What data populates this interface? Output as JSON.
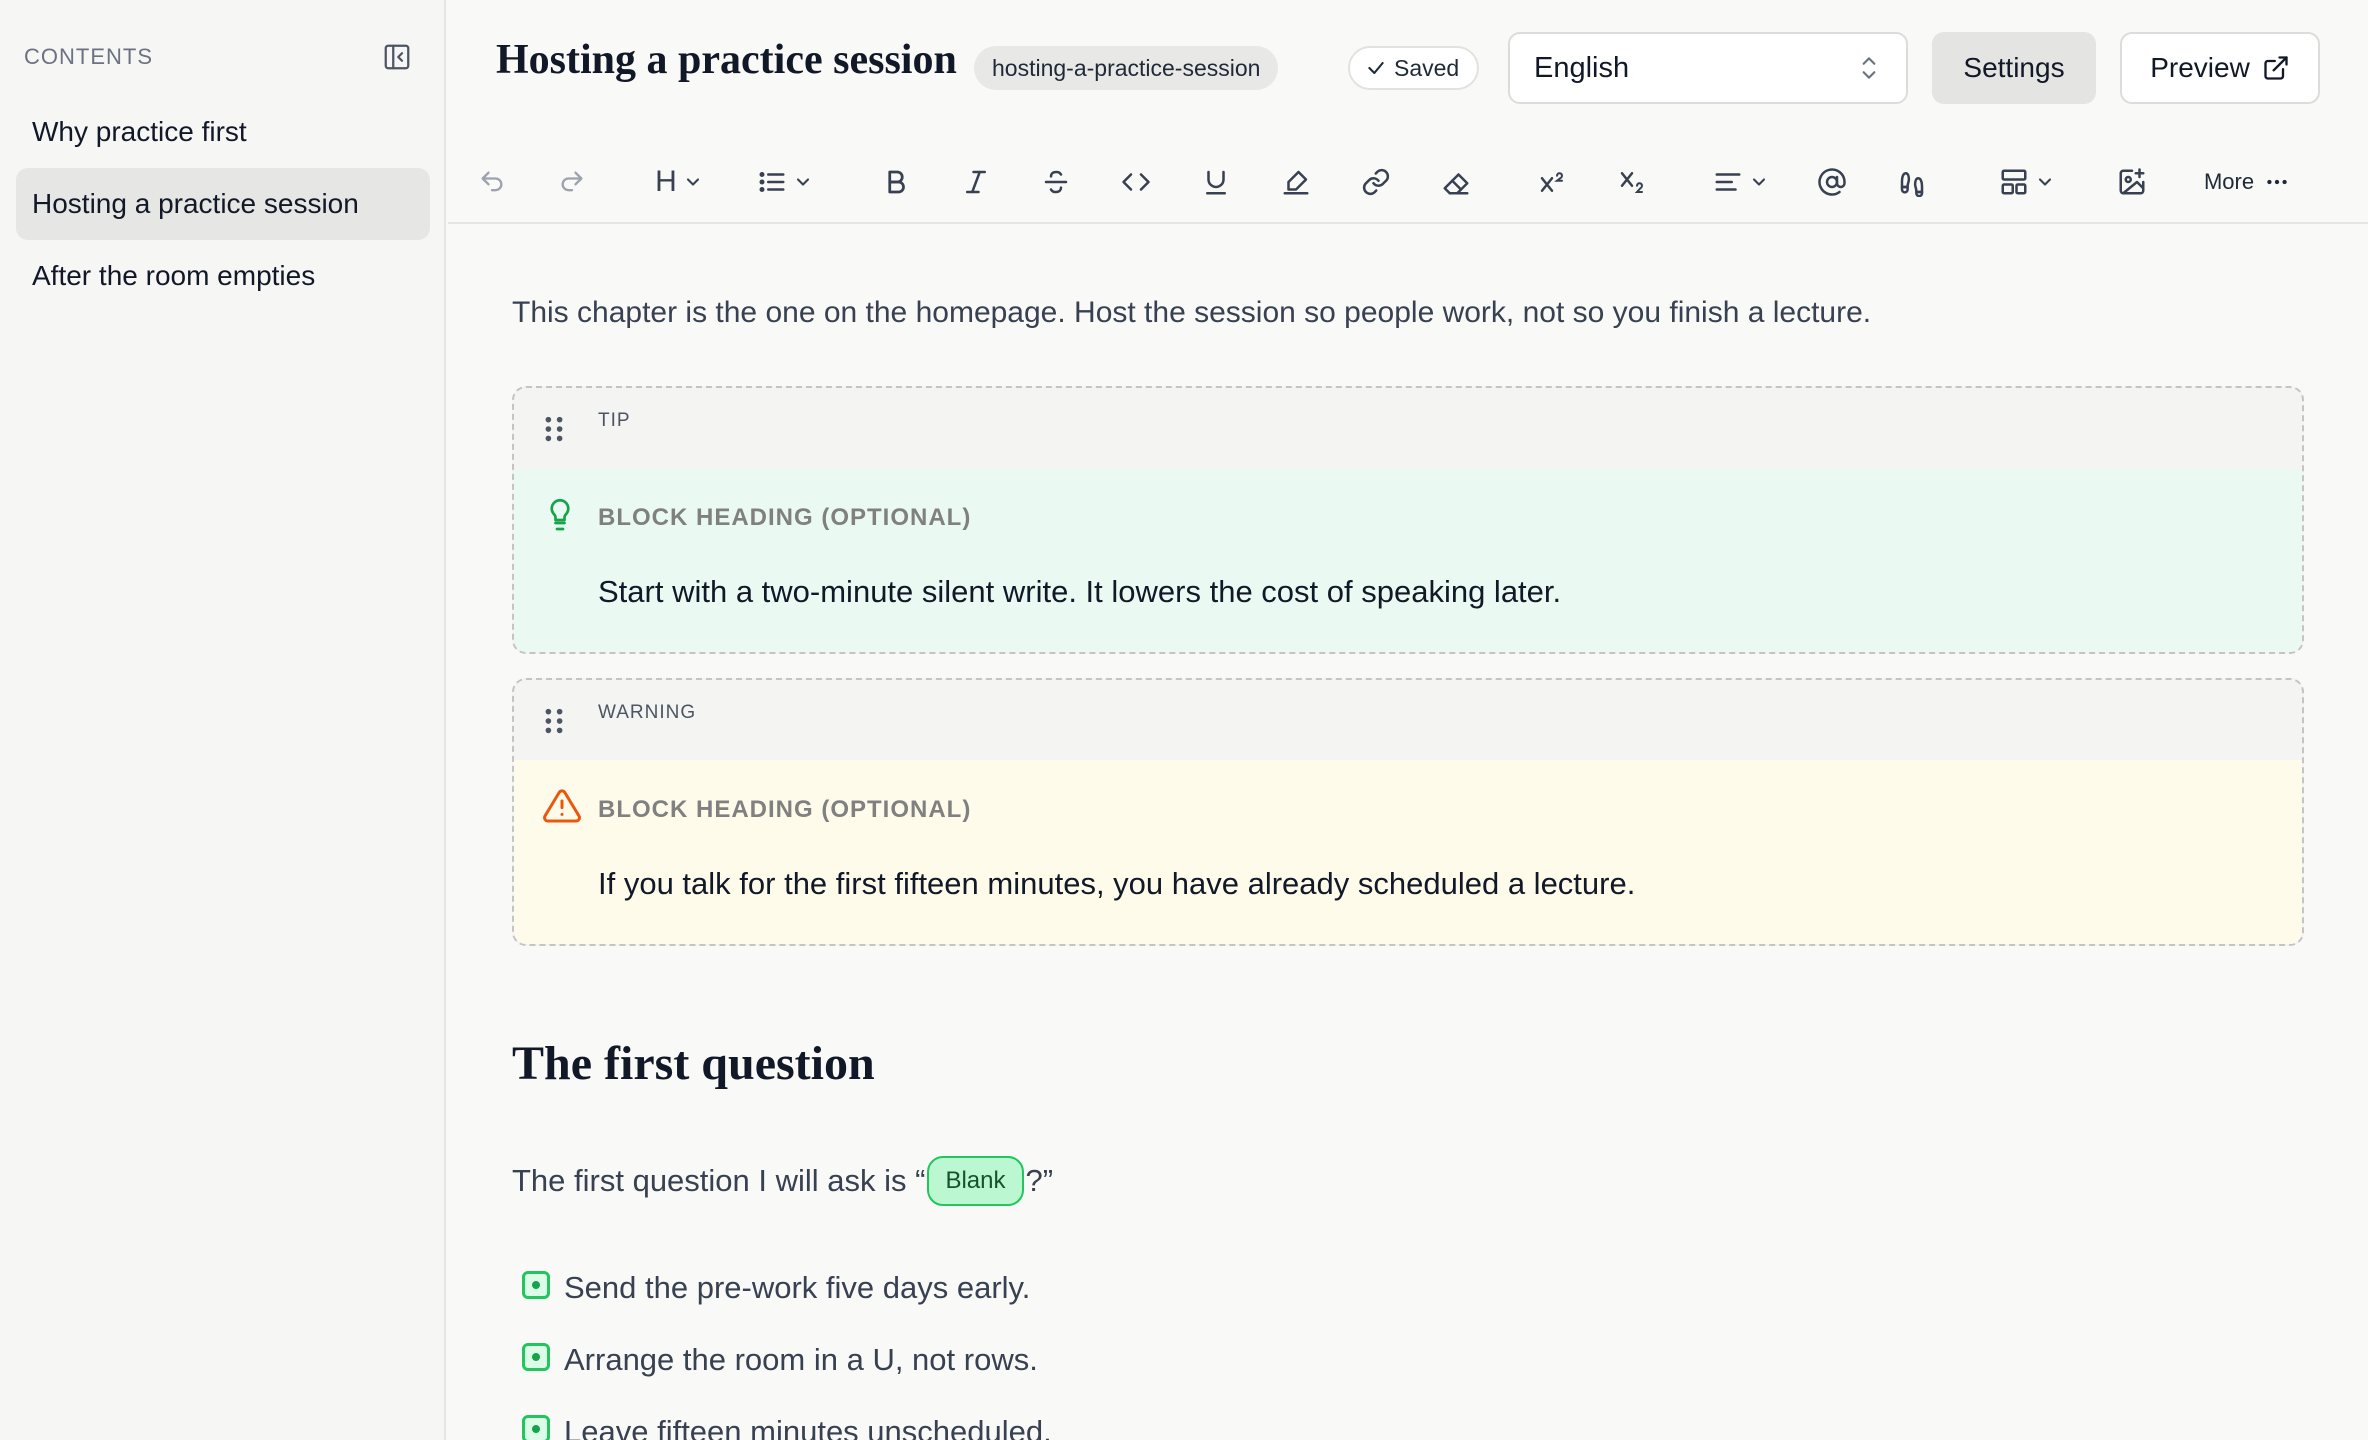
{
  "sidebar": {
    "title": "CONTENTS",
    "items": [
      {
        "label": "Why practice first"
      },
      {
        "label": "Hosting a practice session"
      },
      {
        "label": "After the room empties"
      }
    ]
  },
  "header": {
    "title": "Hosting a practice session",
    "slug": "hosting-a-practice-session",
    "status": "Saved",
    "language": "English",
    "settings_label": "Settings",
    "preview_label": "Preview"
  },
  "toolbar": {
    "heading_label": "H",
    "more_label": "More",
    "icons": [
      "undo-icon",
      "redo-icon",
      "heading-icon",
      "list-icon",
      "bold-icon",
      "italic-icon",
      "strikethrough-icon",
      "code-icon",
      "underline-icon",
      "highlight-icon",
      "link-icon",
      "eraser-icon",
      "superscript-icon",
      "subscript-icon",
      "align-icon",
      "mention-icon",
      "footprints-icon",
      "layout-icon",
      "image-add-icon",
      "more-icon"
    ]
  },
  "content": {
    "intro": "This chapter is the one on the homepage. Host the session so people work, not so you finish a lecture.",
    "callouts": [
      {
        "kind": "TIP",
        "heading": "BLOCK HEADING (OPTIONAL)",
        "text": "Start with a two-minute silent write. It lowers the cost of speaking later.",
        "icon": "lightbulb-icon",
        "accent": "#16a34a"
      },
      {
        "kind": "WARNING",
        "heading": "BLOCK HEADING (OPTIONAL)",
        "text": "If you talk for the first fifteen minutes, you have already scheduled a lecture.",
        "icon": "warning-icon",
        "accent": "#ea580c"
      }
    ],
    "heading": "The first question",
    "question_prefix": "The first question I will ask is “",
    "blank_label": "Blank",
    "question_suffix": "?”",
    "checklist": [
      {
        "text": "Send the pre-work five days early."
      },
      {
        "text": "Arrange the room in a U, not rows."
      },
      {
        "text": "Leave fifteen minutes unscheduled."
      }
    ]
  },
  "colors": {
    "accent_green": "#22c55e",
    "tip_bg": "#eafaf2",
    "warning_bg": "#fffbeb"
  }
}
